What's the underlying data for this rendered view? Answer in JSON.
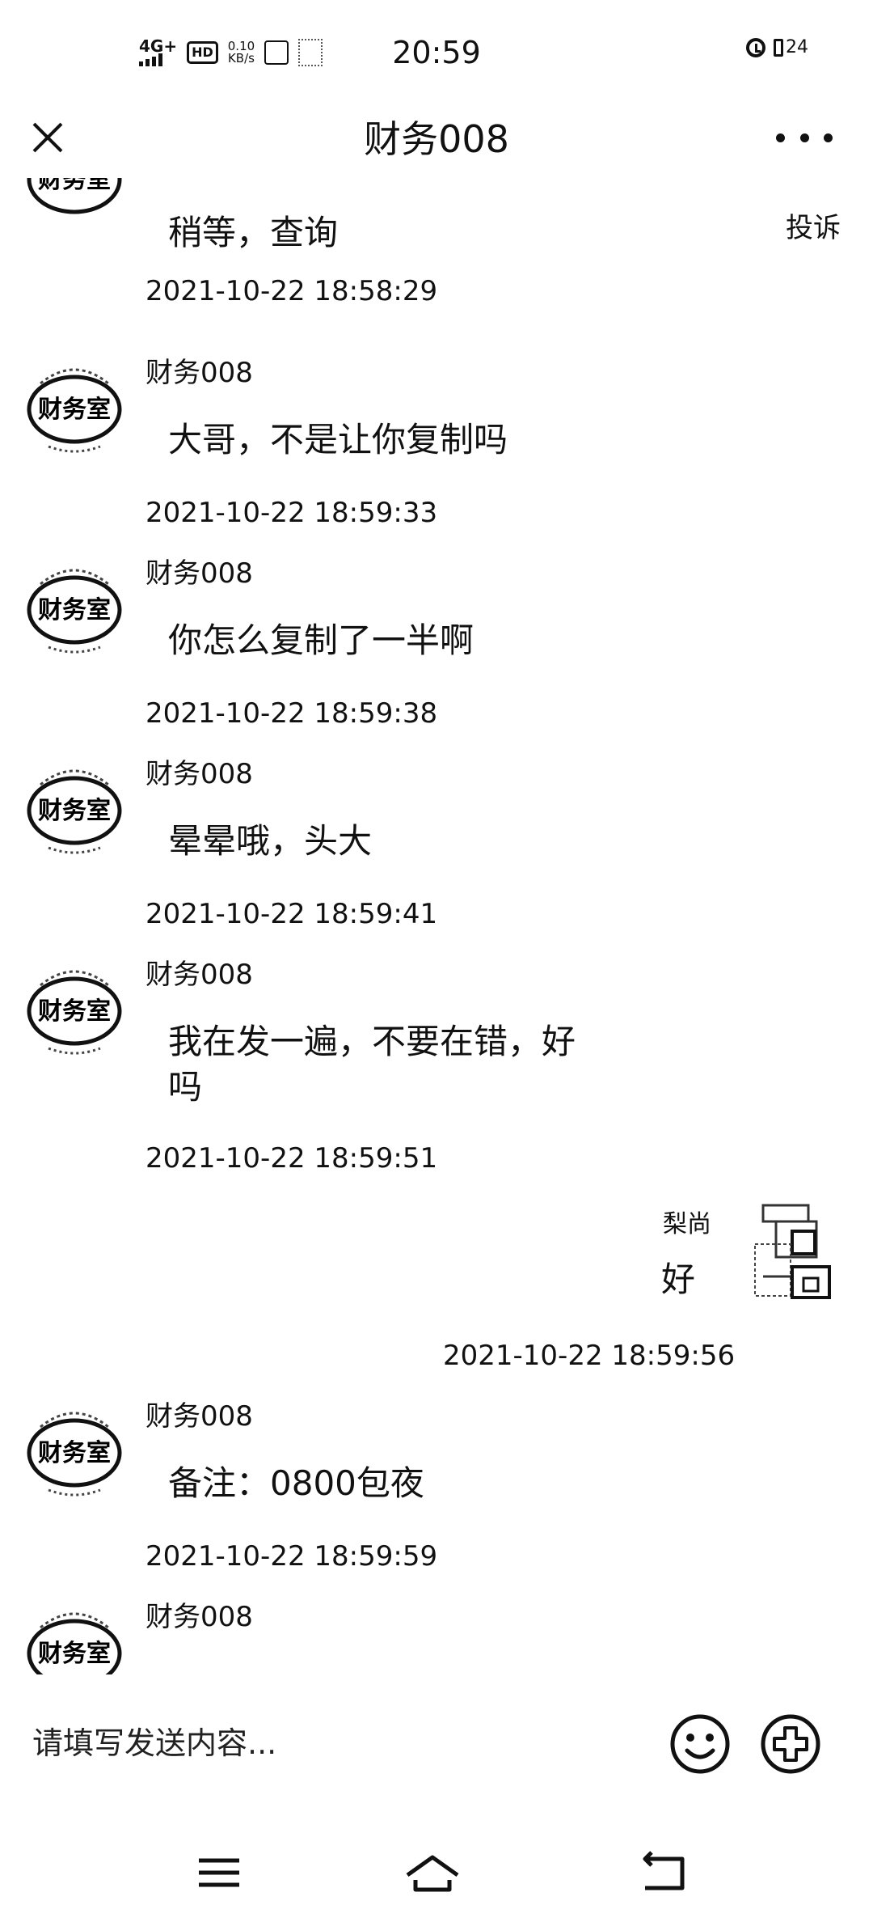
{
  "status_bar": {
    "network": "4G+",
    "hd": "HD",
    "speed_value": "0.10",
    "speed_unit": "KB/s",
    "time": "20:59",
    "battery": "24"
  },
  "header": {
    "title": "财务008"
  },
  "messages": [
    {
      "sender": "",
      "text": "稍等，查询",
      "timestamp": "2021-10-22 18:58:29"
    },
    {
      "sender": "财务008",
      "text": "大哥，不是让你复制吗",
      "timestamp": "2021-10-22 18:59:33"
    },
    {
      "sender": "财务008",
      "text": "你怎么复制了一半啊",
      "timestamp": "2021-10-22 18:59:38"
    },
    {
      "sender": "财务008",
      "text": "晕晕哦，头大",
      "timestamp": "2021-10-22 18:59:41"
    },
    {
      "sender": "财务008",
      "text": "我在发一遍，不要在错，好\n吗",
      "timestamp": "2021-10-22 18:59:51"
    },
    {
      "sender": "财务008",
      "text": "备注：0800包夜",
      "timestamp": "2021-10-22 18:59:59"
    },
    {
      "sender": "财务008",
      "text": "",
      "timestamp": ""
    }
  ],
  "report_label": "投诉",
  "self_message": {
    "sender": "梨尚",
    "text": "好",
    "timestamp": "2021-10-22 18:59:56"
  },
  "avatar_label": "财务室",
  "input": {
    "placeholder": "请填写发送内容..."
  }
}
